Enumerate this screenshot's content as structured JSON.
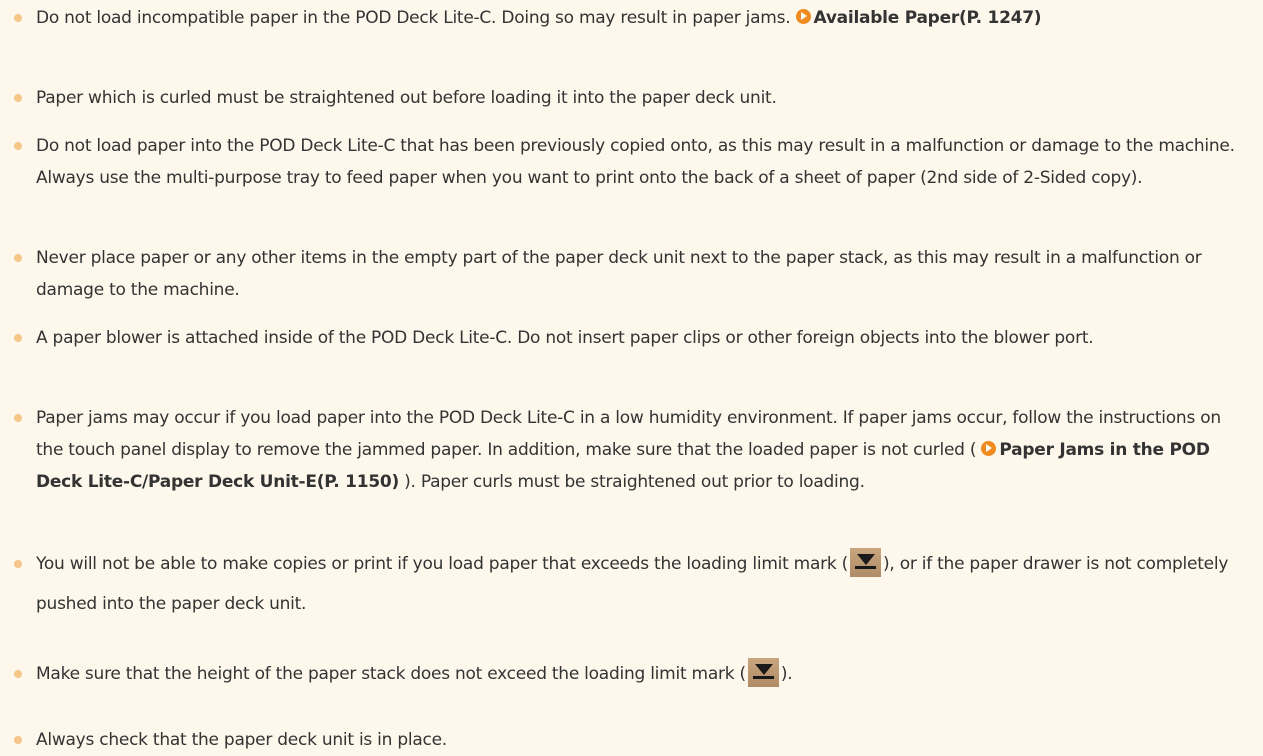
{
  "notes": [
    {
      "before": "Do not load incompatible paper in the POD Deck Lite-C. Doing so may result in paper jams. ",
      "link": "Available Paper(P. 1247)"
    },
    {
      "text": "Paper which is curled must be straightened out before loading it into the paper deck unit."
    },
    {
      "text": "Do not load paper into the POD Deck Lite-C that has been previously copied onto, as this may result in a malfunction or damage to the machine. Always use the multi-purpose tray to feed paper when you want to print onto the back of a sheet of paper (2nd side of 2-Sided copy)."
    },
    {
      "text": "Never place paper or any other items in the empty part of the paper deck unit next to the paper stack, as this may result in a malfunction or damage to the machine."
    },
    {
      "text": "A paper blower is attached inside of the POD Deck Lite-C. Do not insert paper clips or other foreign objects into the blower port."
    },
    {
      "before": "Paper jams may occur if you load paper into the POD Deck Lite-C in a low humidity environment. If paper jams occur, follow the instructions on the touch panel display to remove the jammed paper. In addition, make sure that the loaded paper is not curled ( ",
      "link": "Paper Jams in the POD Deck Lite-C/Paper Deck Unit-E(P. 1150)",
      "after": " ). Paper curls must be straightened out prior to loading."
    },
    {
      "before": "You will not be able to make copies or print if you load paper that exceeds the loading limit mark (",
      "after": "), or if the paper drawer is not completely pushed into the paper deck unit."
    },
    {
      "before": "Make sure that the height of the paper stack does not exceed the loading limit mark (",
      "after": ")."
    },
    {
      "text": "Always check that the paper deck unit is in place."
    }
  ],
  "icons": {
    "link_arrow": "circle-arrow-right-icon",
    "limit_mark": "loading-limit-mark-icon"
  },
  "colors": {
    "background": "#fdf7ec",
    "bullet": "#f6c68a",
    "link_arrow": "#ef8a1e",
    "text": "#333333"
  }
}
